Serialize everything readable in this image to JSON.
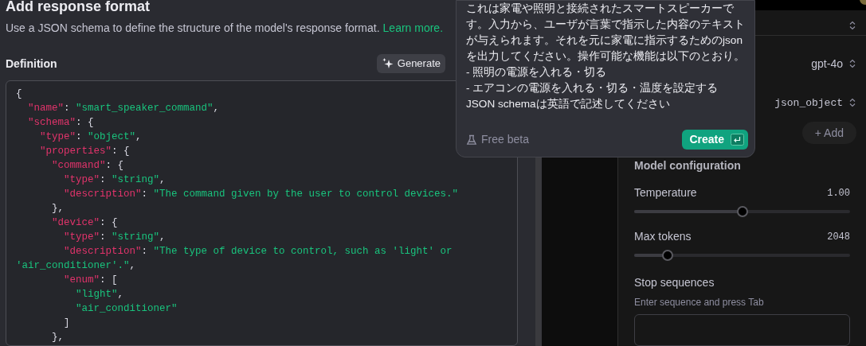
{
  "dialog": {
    "title": "Add response format",
    "description": "Use a JSON schema to define the structure of the model's response format.",
    "learn_more": "Learn more.",
    "definition_label": "Definition",
    "generate_button": "Generate",
    "code_lines": [
      [
        {
          "kind": "punct",
          "t": "{"
        }
      ],
      [
        {
          "kind": "key",
          "t": "  \"name\""
        },
        {
          "kind": "punct",
          "t": ": "
        },
        {
          "kind": "str",
          "t": "\"smart_speaker_command\""
        },
        {
          "kind": "punct",
          "t": ","
        }
      ],
      [
        {
          "kind": "key",
          "t": "  \"schema\""
        },
        {
          "kind": "punct",
          "t": ": {"
        }
      ],
      [
        {
          "kind": "key",
          "t": "    \"type\""
        },
        {
          "kind": "punct",
          "t": ": "
        },
        {
          "kind": "str",
          "t": "\"object\""
        },
        {
          "kind": "punct",
          "t": ","
        }
      ],
      [
        {
          "kind": "key",
          "t": "    \"properties\""
        },
        {
          "kind": "punct",
          "t": ": {"
        }
      ],
      [
        {
          "kind": "key",
          "t": "      \"command\""
        },
        {
          "kind": "punct",
          "t": ": {"
        }
      ],
      [
        {
          "kind": "key",
          "t": "        \"type\""
        },
        {
          "kind": "punct",
          "t": ": "
        },
        {
          "kind": "str",
          "t": "\"string\""
        },
        {
          "kind": "punct",
          "t": ","
        }
      ],
      [
        {
          "kind": "key",
          "t": "        \"description\""
        },
        {
          "kind": "punct",
          "t": ": "
        },
        {
          "kind": "str",
          "t": "\"The command given by the user to control devices.\""
        }
      ],
      [
        {
          "kind": "punct",
          "t": "      },"
        }
      ],
      [
        {
          "kind": "key",
          "t": "      \"device\""
        },
        {
          "kind": "punct",
          "t": ": {"
        }
      ],
      [
        {
          "kind": "key",
          "t": "        \"type\""
        },
        {
          "kind": "punct",
          "t": ": "
        },
        {
          "kind": "str",
          "t": "\"string\""
        },
        {
          "kind": "punct",
          "t": ","
        }
      ],
      [
        {
          "kind": "key",
          "t": "        \"description\""
        },
        {
          "kind": "punct",
          "t": ": "
        },
        {
          "kind": "str",
          "t": "\"The type of device to control, such as 'light' or"
        }
      ],
      [
        {
          "kind": "str",
          "t": "'air_conditioner'.\""
        },
        {
          "kind": "punct",
          "t": ","
        }
      ],
      [
        {
          "kind": "key",
          "t": "        \"enum\""
        },
        {
          "kind": "punct",
          "t": ": ["
        }
      ],
      [
        {
          "kind": "str",
          "t": "          \"light\""
        },
        {
          "kind": "punct",
          "t": ","
        }
      ],
      [
        {
          "kind": "str",
          "t": "          \"air_conditioner\""
        }
      ],
      [
        {
          "kind": "punct",
          "t": "        ]"
        }
      ],
      [
        {
          "kind": "punct",
          "t": "      },"
        }
      ]
    ]
  },
  "popup": {
    "lines": [
      "これは家電や照明と接続されたスマートスピーカーで",
      "す。入力から、ユーザが言葉で指示した内容のテキスト",
      "が与えられます。それを元に家電に指示するためのjson",
      "を出力してください。操作可能な機能は以下のとおり。",
      "- 照明の電源を入れる・切る",
      "- エアコンの電源を入れる・切る・温度を設定する",
      "JSON schemaは英語で記述してください"
    ],
    "free_beta": "Free beta",
    "create_button": "Create"
  },
  "settings": {
    "model": "gpt-4o",
    "response_format": "json_object",
    "add_button": "+ Add",
    "section_title": "Model configuration",
    "sliders": [
      {
        "label": "Temperature",
        "reading": "1.00",
        "level": 0.5
      },
      {
        "label": "Max tokens",
        "reading": "2048",
        "level": 0.136
      }
    ],
    "stop_sequences": {
      "label": "Stop sequences",
      "hint": "Enter sequence and press Tab"
    }
  }
}
